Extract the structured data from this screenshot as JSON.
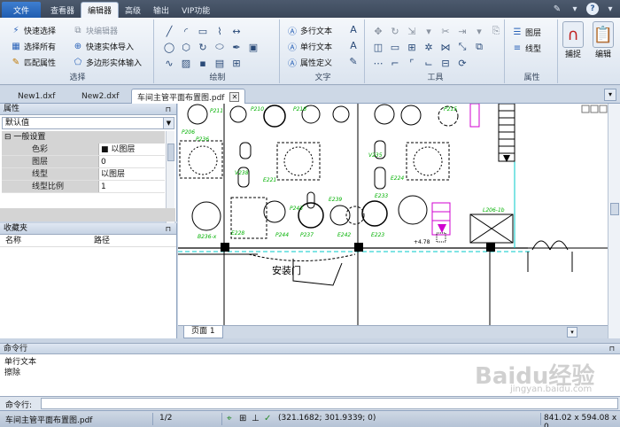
{
  "ribbon_tabs": {
    "file": "文件",
    "tabs": [
      "查看器",
      "编辑器",
      "高级",
      "输出",
      "VIP功能"
    ],
    "active": 1
  },
  "ribbon": {
    "select_group": {
      "title": "选择",
      "quick_select": "快速选择",
      "select_all": "选择所有",
      "match_props": "匹配属性",
      "block_editor": "块编辑器",
      "quick_solid_import": "快速实体导入",
      "polygon_solid_import": "多边形实体输入"
    },
    "draw_group": {
      "title": "绘制"
    },
    "text_group": {
      "title": "文字",
      "mtext": "多行文本",
      "stext": "单行文本",
      "attdef": "属性定义"
    },
    "tools_group": {
      "title": "工具"
    },
    "props_group": {
      "title": "属性",
      "layer": "图层",
      "linetype": "线型"
    },
    "snap": "捕捉",
    "edit": "编辑"
  },
  "doc_tabs": [
    "New1.dxf",
    "New2.dxf",
    "车间主管平面布置图.pdf"
  ],
  "properties": {
    "title": "属性",
    "combo": "默认值",
    "category": "一般设置",
    "rows": [
      {
        "k": "色彩",
        "v": "■ 以图层"
      },
      {
        "k": "图层",
        "v": "0"
      },
      {
        "k": "线型",
        "v": "以图层"
      },
      {
        "k": "线型比例",
        "v": "1"
      }
    ]
  },
  "favorites": {
    "title": "收藏夹",
    "col_name": "名称",
    "col_path": "路径"
  },
  "canvas": {
    "labels": [
      "P206",
      "P210",
      "P218",
      "V238",
      "V235",
      "E221",
      "E224",
      "L206-1b",
      "E242",
      "E233",
      "E223",
      "E239",
      "P243",
      "P244",
      "P237",
      "B236-x",
      "E228",
      "P236",
      "安装门",
      "+4.78",
      "P211",
      "P215"
    ],
    "page_tab": "页面 1"
  },
  "command": {
    "title": "命令行",
    "history": [
      "单行文本",
      "擦除"
    ],
    "prompt": "命令行:"
  },
  "status": {
    "file": "车间主管平面布置图.pdf",
    "page": "1/2",
    "coords": "(321.1682; 301.9339; 0)",
    "size": "841.02 x 594.08 x 0"
  },
  "watermark": {
    "main": "Baidu经验",
    "sub": "jingyan.baidu.com"
  },
  "colors": {
    "accent": "#1f5cb0",
    "cad_green": "#00b000",
    "cad_magenta": "#d000d0",
    "cad_cyan": "#00c8c8"
  }
}
